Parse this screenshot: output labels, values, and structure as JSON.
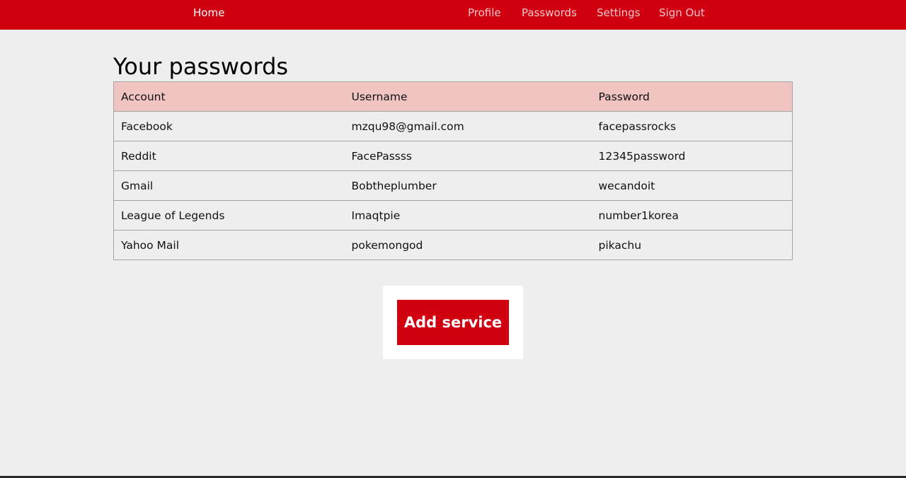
{
  "nav": {
    "home": "Home",
    "profile": "Profile",
    "passwords": "Passwords",
    "settings": "Settings",
    "sign_out": "Sign Out"
  },
  "main": {
    "title": "Your passwords",
    "table": {
      "headers": [
        "Account",
        "Username",
        "Password"
      ],
      "rows": [
        [
          "Facebook",
          "mzqu98@gmail.com",
          "facepassrocks"
        ],
        [
          "Reddit",
          "FacePassss",
          "12345password"
        ],
        [
          "Gmail",
          "Bobtheplumber",
          "wecandoit"
        ],
        [
          "League of Legends",
          "Imaqtpie",
          "number1korea"
        ],
        [
          "Yahoo Mail",
          "pokemongod",
          "pikachu"
        ]
      ]
    },
    "add_button": "Add service"
  },
  "colors": {
    "brand_red": "#d10010",
    "header_row": "#f0c4c1",
    "background": "#eeeeee"
  }
}
